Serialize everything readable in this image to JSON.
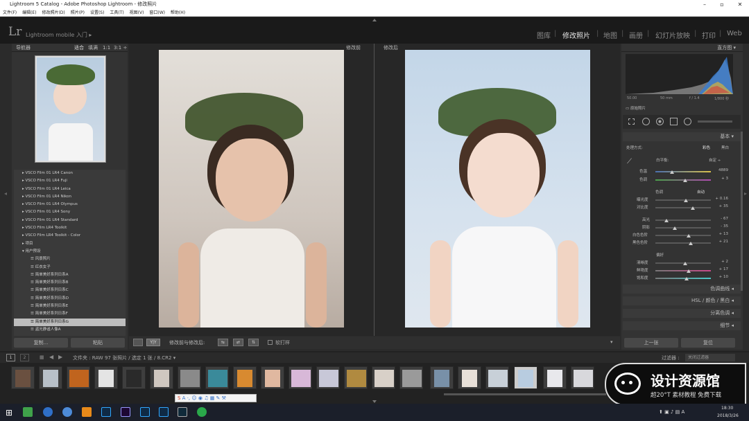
{
  "window": {
    "title": "Lightroom 5 Catalog - Adobe Photoshop Lightroom - 修改照片"
  },
  "menu": [
    "文件(F)",
    "编辑(E)",
    "修改照片(D)",
    "照片(P)",
    "设置(S)",
    "工具(T)",
    "视图(V)",
    "窗口(W)",
    "帮助(H)"
  ],
  "identity": {
    "logo": "Lr",
    "subtitle": "Lightroom mobile 入门  ▸"
  },
  "modules": [
    "图库",
    "修改照片",
    "地图",
    "画册",
    "幻灯片放映",
    "打印",
    "Web"
  ],
  "navigator": {
    "title": "导航器",
    "zoom": [
      "适合",
      "填满",
      "1:1",
      "3:1 ÷"
    ]
  },
  "presets": [
    "VSCO Film 01 LR4 Canon",
    "VSCO Film 01 LR4 Fuji",
    "VSCO Film 01 LR4 Leica",
    "VSCO Film 01 LR4 Nikon",
    "VSCO Film 01 LR4 Olympus",
    "VSCO Film 01 LR4 Sony",
    "VSCO Film 01 LR4 Standard",
    "VSCO Film LR4 Toolkit",
    "VSCO Film LR4 Toolkit - Color",
    "项目",
    "用户预设",
    "风景照片",
    "红衣女子",
    "简单美好系列日系A",
    "简单美好系列日系B",
    "简单美好系列日系C",
    "简单美好系列日系D",
    "简单美好系列日系E",
    "简单美好系列日系F",
    "简单美好系列日系G",
    "盗光静谧人像A"
  ],
  "left_buttons": {
    "copy": "复制...",
    "paste": "粘贴"
  },
  "view": {
    "before": "修改前",
    "after": "修改后"
  },
  "toolbar": {
    "mode": "Y|Y",
    "label": "修改前与修改后:",
    "softproof": "软打样"
  },
  "histogram": {
    "title": "直方图",
    "readout": [
      "50.00",
      "50 mm",
      "f / 1.4",
      "1/800 秒"
    ],
    "orig": "原始照片"
  },
  "basic": {
    "title": "基本",
    "treatment_label": "处理方式:",
    "color": "彩色",
    "bw": "黑白",
    "wb_label": "白平衡:",
    "wb_value": "自定 ÷",
    "temp_label": "色温",
    "temp_value": "4889",
    "tint_label": "色调",
    "tint_value": "+ 3",
    "tone_label": "色调",
    "tone_auto": "自动",
    "exposure_label": "曝光度",
    "exposure_value": "+ 0.16",
    "contrast_label": "对比度",
    "contrast_value": "+ 35",
    "highlights_label": "高光",
    "highlights_value": "- 67",
    "shadows_label": "阴影",
    "shadows_value": "- 35",
    "whites_label": "白色色阶",
    "whites_value": "+ 13",
    "blacks_label": "黑色色阶",
    "blacks_value": "+ 21",
    "presence_label": "偏好",
    "clarity_label": "清晰度",
    "clarity_value": "+ 2",
    "vibrance_label": "鲜艳度",
    "vibrance_value": "+ 17",
    "saturation_label": "饱和度",
    "saturation_value": "+ 10"
  },
  "sections": {
    "tone_curve": "色调曲线 ◂",
    "hsl": "HSL  /  颜色  /  黑白 ◂",
    "split": "分离色调 ◂",
    "detail": "细节 ◂"
  },
  "right_buttons": {
    "prev": "上一张",
    "reset": "复位"
  },
  "filmstrip": {
    "pages": [
      "1",
      "2"
    ],
    "path": "文件夹 : RAW   97 张照片 / 选定 1 张 / 8.CR2 ▾",
    "filter_label": "过滤器 :",
    "filter_value": "关闭过滤器"
  },
  "watermark": {
    "title": "设计资源馆",
    "tagline": "超20°T 素材教程 免费下载"
  },
  "taskbar": {
    "time": "18:30",
    "date": "2018/3/26"
  }
}
